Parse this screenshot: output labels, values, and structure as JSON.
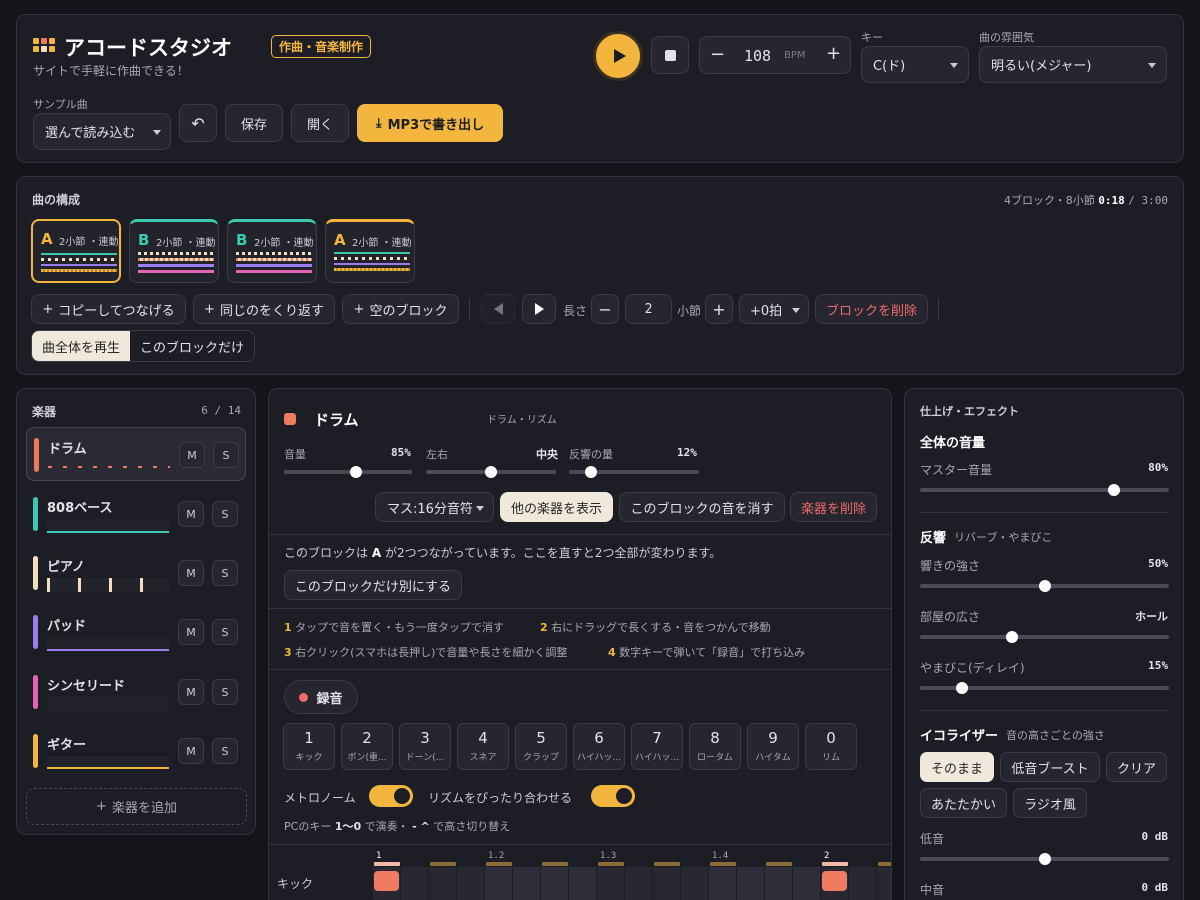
{
  "header": {
    "app_title": "アコードスタジオ",
    "tag": "作曲・音楽制作",
    "subtitle": "サイトで手軽に作曲できる！",
    "bpm": "108",
    "bpm_unit": "BPM",
    "key_label": "キー",
    "key_value": "C(ド)",
    "mood_label": "曲の雰囲気",
    "mood_value": "明るい(メジャー)",
    "sample_label": "サンプル曲",
    "sample_value": "選んで読み込む",
    "save_label": "保存",
    "open_label": "開く",
    "export_label": "MP3で書き出し"
  },
  "structure": {
    "title": "曲の構成",
    "summary": "4ブロック・8小節",
    "time_current": "0:18",
    "time_total": "/ 3:00",
    "blocks": [
      {
        "letter": "A",
        "meta": "2小節 ・連動"
      },
      {
        "letter": "B",
        "meta": "2小節 ・連動"
      },
      {
        "letter": "B",
        "meta": "2小節 ・連動"
      },
      {
        "letter": "A",
        "meta": "2小節 ・連動"
      }
    ],
    "copy_join": "コピーしてつなげる",
    "repeat_same": "同じのをくり返す",
    "empty_block": "空のブロック",
    "length_label": "長さ",
    "length_value": "2",
    "measure_unit": "小節",
    "beat_value": "+0拍",
    "delete_block": "ブロックを削除",
    "play_whole": "曲全体を再生",
    "play_block": "このブロックだけ"
  },
  "instruments": {
    "title": "楽器",
    "count": "6 / 14",
    "items": [
      {
        "name": "ドラム",
        "color": "#ef7b5f"
      },
      {
        "name": "808ベース",
        "color": "#3cc9b1"
      },
      {
        "name": "ピアノ",
        "color": "#f3dfbf"
      },
      {
        "name": "パッド",
        "color": "#9b7df0"
      },
      {
        "name": "シンセリード",
        "color": "#e565b4"
      },
      {
        "name": "ギター",
        "color": "#f2b63f"
      }
    ],
    "mute": "M",
    "solo": "S",
    "add": "楽器を追加"
  },
  "editor": {
    "name": "ドラム",
    "category": "ドラム・リズム",
    "volume_label": "音量",
    "volume_value": "85%",
    "volume_level": 0.56,
    "pan_label": "左右",
    "pan_value": "中央",
    "pan_level": 0.5,
    "reverb_label": "反響の量",
    "reverb_value": "12%",
    "reverb_level": 0.17,
    "grid_select": "マス:16分音符",
    "show_others": "他の楽器を表示",
    "mute_block": "このブロックの音を消す",
    "delete_inst": "楽器を削除",
    "link_text_pre": "このブロックは",
    "link_letter": "A",
    "link_text_post": "が2つつながっています。ここを直すと2つ全部が変わります。",
    "unlink": "このブロックだけ別にする",
    "tips": [
      {
        "n": "1",
        "t": "タップで音を置く・もう一度タップで消す"
      },
      {
        "n": "2",
        "t": "右にドラッグで長くする・音をつかんで移動"
      },
      {
        "n": "3",
        "t": "右クリック(スマホは長押し)で音量や長さを細かく調整"
      },
      {
        "n": "4",
        "t": "数字キーで弾いて「録音」で打ち込み"
      }
    ],
    "record": "録音",
    "pads": [
      {
        "n": "1",
        "name": "キック"
      },
      {
        "n": "2",
        "name": "ボン(重..."
      },
      {
        "n": "3",
        "name": "ドーン(..."
      },
      {
        "n": "4",
        "name": "スネア"
      },
      {
        "n": "5",
        "name": "クラップ"
      },
      {
        "n": "6",
        "name": "ハイハッ..."
      },
      {
        "n": "7",
        "name": "ハイハッ..."
      },
      {
        "n": "8",
        "name": "ロータム"
      },
      {
        "n": "9",
        "name": "ハイタム"
      },
      {
        "n": "0",
        "name": "リム"
      }
    ],
    "metronome": "メトロノーム",
    "quantize": "リズムをぴったり合わせる",
    "key_hint_pre": "PCのキー",
    "key_hint_keys": "1〜0",
    "key_hint_mid": "で演奏・",
    "key_hint_keys2": "- ^",
    "key_hint_post": "で高さ切り替え",
    "row_label": "キック",
    "beat_marks": [
      "1",
      "1.2",
      "1.3",
      "1.4",
      "2"
    ]
  },
  "effects": {
    "title": "仕上げ・エフェクト",
    "master_section": "全体の音量",
    "master_label": "マスター音量",
    "master_value": "80%",
    "master_level": 0.78,
    "reverb_section": "反響",
    "reverb_sub": "リバーブ・やまびこ",
    "strength_label": "響きの強さ",
    "strength_value": "50%",
    "strength_level": 0.5,
    "room_label": "部屋の広さ",
    "room_value": "ホール",
    "room_level": 0.37,
    "delay_label": "やまびこ(ディレイ)",
    "delay_value": "15%",
    "delay_level": 0.17,
    "eq_section": "イコライザー",
    "eq_sub": "音の高さごとの強さ",
    "presets": [
      "そのまま",
      "低音ブースト",
      "クリア",
      "あたたかい",
      "ラジオ風"
    ],
    "bass_label": "低音",
    "bass_value": "0 dB",
    "bass_level": 0.5,
    "mid_label": "中音",
    "mid_value": "0 dB"
  }
}
